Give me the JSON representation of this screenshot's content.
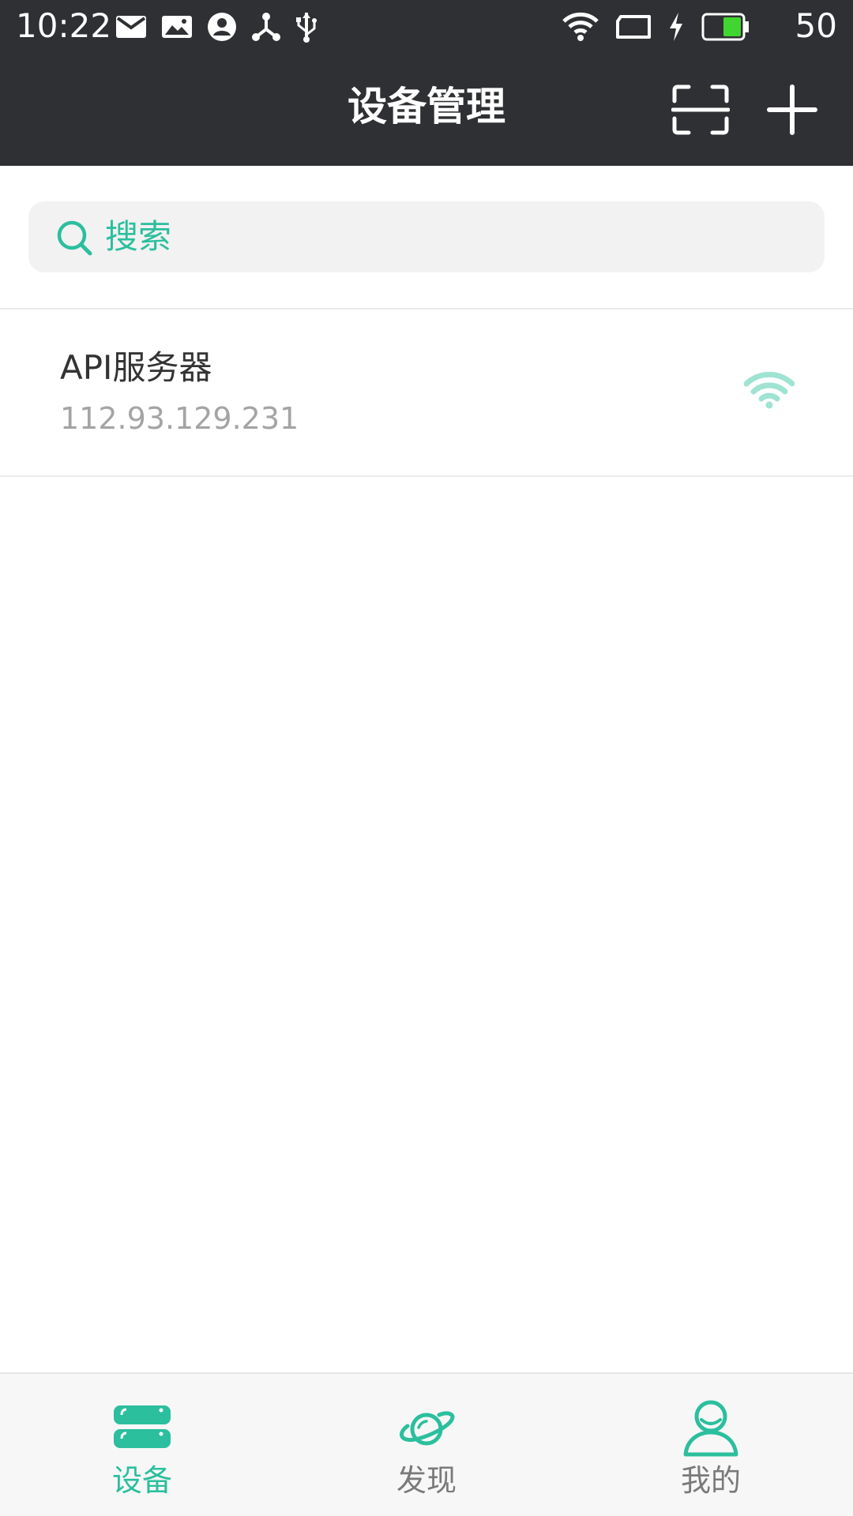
{
  "status_bar": {
    "time": "10:22",
    "left_icons": [
      "mail-icon",
      "image-icon",
      "account-icon",
      "share-icon",
      "usb-icon"
    ],
    "right_icons": [
      "wifi-icon",
      "screen-icon",
      "charging-icon",
      "battery-icon"
    ],
    "battery_level": "50",
    "battery_fill_fraction": 0.5
  },
  "app_bar": {
    "title": "设备管理",
    "actions": [
      "scan-icon",
      "plus-icon"
    ]
  },
  "search": {
    "placeholder": "搜索"
  },
  "devices": [
    {
      "name": "API服务器",
      "ip": "112.93.129.231",
      "status_icon": "wifi-icon"
    }
  ],
  "bottom_nav": {
    "tabs": [
      {
        "label": "设备",
        "icon": "server-icon",
        "active": true
      },
      {
        "label": "发现",
        "icon": "planet-icon",
        "active": false
      },
      {
        "label": "我的",
        "icon": "user-icon",
        "active": false
      }
    ]
  },
  "colors": {
    "bar_background": "#2f3033",
    "accent": "#2bbf9e",
    "inactive": "#7a7a7a",
    "divider": "#ececec"
  }
}
